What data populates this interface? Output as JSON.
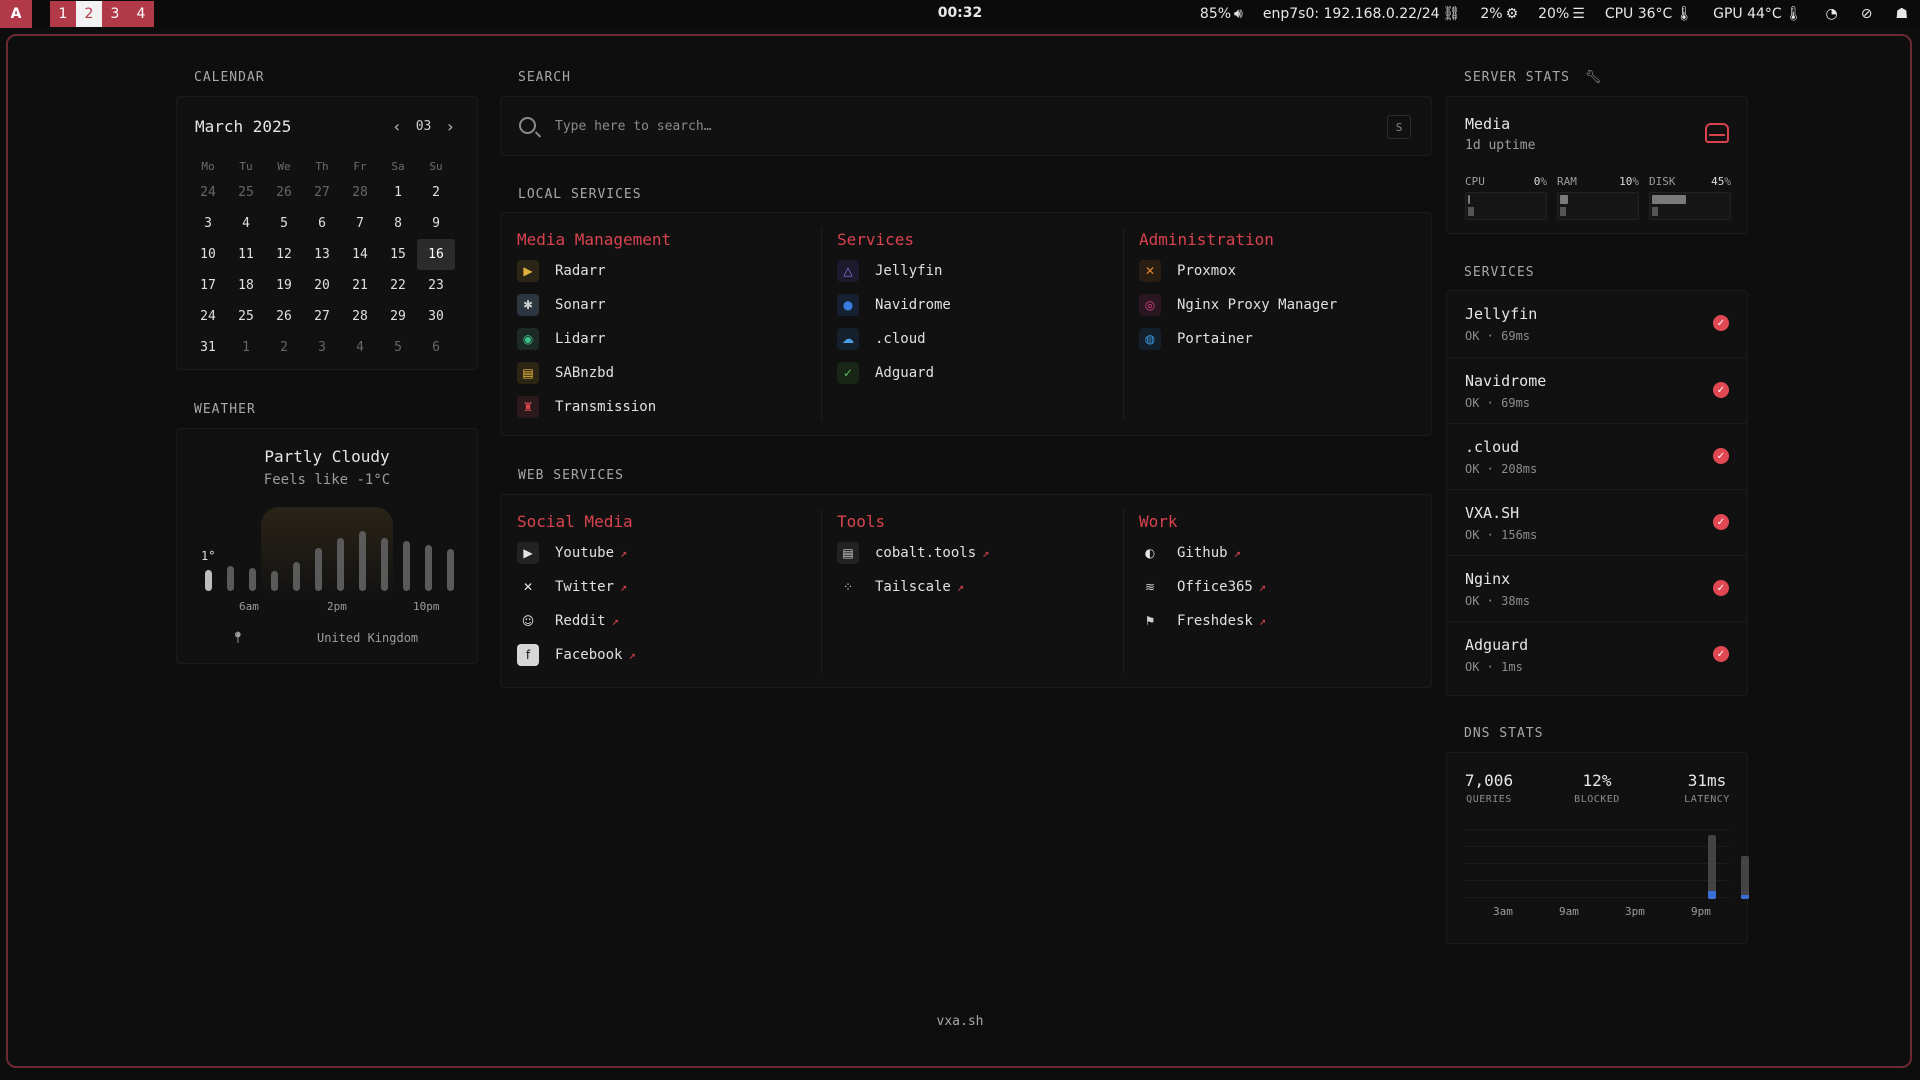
{
  "topbar": {
    "logo": "A",
    "workspaces": [
      "1",
      "2",
      "3",
      "4"
    ],
    "active_workspace": "2",
    "clock": "00:32",
    "volume": "85%",
    "network": "enp7s0: 192.168.0.22/24",
    "cpu_usage": "2%",
    "memory": "20%",
    "cpu_temp": "CPU 36°C",
    "gpu_temp": "GPU 44°C"
  },
  "calendar": {
    "label": "CALENDAR",
    "month": "March 2025",
    "month_num": "03",
    "dow": [
      "Mo",
      "Tu",
      "We",
      "Th",
      "Fr",
      "Sa",
      "Su"
    ],
    "days": [
      {
        "d": "24",
        "m": true
      },
      {
        "d": "25",
        "m": true
      },
      {
        "d": "26",
        "m": true
      },
      {
        "d": "27",
        "m": true
      },
      {
        "d": "28",
        "m": true
      },
      {
        "d": "1"
      },
      {
        "d": "2"
      },
      {
        "d": "3"
      },
      {
        "d": "4"
      },
      {
        "d": "5"
      },
      {
        "d": "6"
      },
      {
        "d": "7"
      },
      {
        "d": "8"
      },
      {
        "d": "9"
      },
      {
        "d": "10"
      },
      {
        "d": "11"
      },
      {
        "d": "12"
      },
      {
        "d": "13"
      },
      {
        "d": "14"
      },
      {
        "d": "15"
      },
      {
        "d": "16",
        "today": true
      },
      {
        "d": "17"
      },
      {
        "d": "18"
      },
      {
        "d": "19"
      },
      {
        "d": "20"
      },
      {
        "d": "21"
      },
      {
        "d": "22"
      },
      {
        "d": "23"
      },
      {
        "d": "24"
      },
      {
        "d": "25"
      },
      {
        "d": "26"
      },
      {
        "d": "27"
      },
      {
        "d": "28"
      },
      {
        "d": "29"
      },
      {
        "d": "30"
      },
      {
        "d": "31"
      },
      {
        "d": "1",
        "m": true
      },
      {
        "d": "2",
        "m": true
      },
      {
        "d": "3",
        "m": true
      },
      {
        "d": "4",
        "m": true
      },
      {
        "d": "5",
        "m": true
      },
      {
        "d": "6",
        "m": true
      }
    ]
  },
  "weather": {
    "label": "WEATHER",
    "condition": "Partly Cloudy",
    "feels_like": "Feels like -1°C",
    "current_temp": "1°",
    "ticks": [
      "6am",
      "2pm",
      "10pm"
    ],
    "location": "United Kingdom",
    "hourly_levels": [
      0.3,
      0.35,
      0.33,
      0.28,
      0.42,
      0.62,
      0.75,
      0.85,
      0.75,
      0.72,
      0.65,
      0.6
    ]
  },
  "search": {
    "label": "SEARCH",
    "placeholder": "Type here to search…",
    "shortcut": "S"
  },
  "local_services": {
    "label": "LOCAL SERVICES",
    "groups": [
      {
        "title": "Media Management",
        "items": [
          {
            "name": "Radarr",
            "icon": "radarr-icon",
            "glyph": "▶",
            "color": "#e0b040",
            "bg": "#2a2516"
          },
          {
            "name": "Sonarr",
            "icon": "sonarr-icon",
            "glyph": "✱",
            "color": "#cfcfcf",
            "bg": "#2b3640"
          },
          {
            "name": "Lidarr",
            "icon": "lidarr-icon",
            "glyph": "◉",
            "color": "#3fc28c",
            "bg": "#1b2a25"
          },
          {
            "name": "SABnzbd",
            "icon": "sabnzbd-icon",
            "glyph": "▤",
            "color": "#f0c040",
            "bg": "#2d2614"
          },
          {
            "name": "Transmission",
            "icon": "transmission-icon",
            "glyph": "♜",
            "color": "#d9434f",
            "bg": "#2a1a1c"
          }
        ]
      },
      {
        "title": "Services",
        "items": [
          {
            "name": "Jellyfin",
            "icon": "jellyfin-icon",
            "glyph": "△",
            "color": "#9b7cf0",
            "bg": "#1c1a2c"
          },
          {
            "name": "Navidrome",
            "icon": "navidrome-icon",
            "glyph": "●",
            "color": "#3a7be0",
            "bg": "#162033"
          },
          {
            "name": ".cloud",
            "icon": "cloud-icon",
            "glyph": "☁",
            "color": "#4aa0e8",
            "bg": "#14202c"
          },
          {
            "name": "Adguard",
            "icon": "adguard-icon",
            "glyph": "✓",
            "color": "#5fbf5f",
            "bg": "#172617"
          }
        ]
      },
      {
        "title": "Administration",
        "items": [
          {
            "name": "Proxmox",
            "icon": "proxmox-icon",
            "glyph": "✕",
            "color": "#e58a2c",
            "bg": "#2a1e14"
          },
          {
            "name": "Nginx Proxy Manager",
            "icon": "nginx-proxy-manager-icon",
            "glyph": "◎",
            "color": "#e04a8a",
            "bg": "#2a1620"
          },
          {
            "name": "Portainer",
            "icon": "portainer-icon",
            "glyph": "◍",
            "color": "#3aa0e8",
            "bg": "#13202c"
          }
        ]
      }
    ]
  },
  "web_services": {
    "label": "WEB SERVICES",
    "ext_arrow": "↗",
    "groups": [
      {
        "title": "Social Media",
        "items": [
          {
            "name": "Youtube",
            "icon": "youtube-icon",
            "glyph": "▶",
            "color": "#e6e6e6",
            "bg": "#222"
          },
          {
            "name": "Twitter",
            "icon": "twitter-x-icon",
            "glyph": "✕",
            "color": "#e6e6e6",
            "bg": "transparent"
          },
          {
            "name": "Reddit",
            "icon": "reddit-icon",
            "glyph": "☺",
            "color": "#e6e6e6",
            "bg": "transparent"
          },
          {
            "name": "Facebook",
            "icon": "facebook-icon",
            "glyph": "f",
            "color": "#111",
            "bg": "#d6d6d6"
          }
        ]
      },
      {
        "title": "Tools",
        "items": [
          {
            "name": "cobalt.tools",
            "icon": "cobalt-tools-icon",
            "glyph": "▤",
            "color": "#cfcfcf",
            "bg": "#222"
          },
          {
            "name": "Tailscale",
            "icon": "tailscale-icon",
            "glyph": "⁘",
            "color": "#cfcfcf",
            "bg": "transparent"
          }
        ]
      },
      {
        "title": "Work",
        "items": [
          {
            "name": "Github",
            "icon": "github-icon",
            "glyph": "◐",
            "color": "#e6e6e6",
            "bg": "transparent"
          },
          {
            "name": "Office365",
            "icon": "office365-icon",
            "glyph": "≋",
            "color": "#cfcfcf",
            "bg": "transparent"
          },
          {
            "name": "Freshdesk",
            "icon": "freshdesk-icon",
            "glyph": "⚑",
            "color": "#cfcfcf",
            "bg": "transparent"
          }
        ]
      }
    ]
  },
  "server_stats": {
    "label": "SERVER STATS",
    "name": "Media",
    "uptime": "1d uptime",
    "metrics": [
      {
        "label": "CPU",
        "value": "0",
        "unit": "%",
        "fraction": 0.0
      },
      {
        "label": "RAM",
        "value": "10",
        "unit": "%",
        "fraction": 0.1
      },
      {
        "label": "DISK",
        "value": "45",
        "unit": "%",
        "fraction": 0.45
      }
    ]
  },
  "services_status": {
    "label": "SERVICES",
    "items": [
      {
        "name": "Jellyfin",
        "meta": "OK · 69ms"
      },
      {
        "name": "Navidrome",
        "meta": "OK · 69ms"
      },
      {
        "name": ".cloud",
        "meta": "OK · 208ms"
      },
      {
        "name": "VXA.SH",
        "meta": "OK · 156ms"
      },
      {
        "name": "Nginx",
        "meta": "OK · 38ms"
      },
      {
        "name": "Adguard",
        "meta": "OK · 1ms"
      }
    ]
  },
  "dns_stats": {
    "label": "DNS STATS",
    "stats": [
      {
        "value": "7,006",
        "label": "QUERIES"
      },
      {
        "value": "12%",
        "label": "BLOCKED"
      },
      {
        "value": "31ms",
        "label": "LATENCY"
      }
    ],
    "ticks": [
      "3am",
      "9am",
      "3pm",
      "9pm"
    ],
    "bars": [
      {
        "slot": 7,
        "queries": 0.92,
        "blocked": 0.12
      },
      {
        "slot": 8,
        "queries": 0.62,
        "blocked": 0.05
      }
    ],
    "blocked_color": "#3b6fd8"
  },
  "footer": "vxa.sh",
  "colors": {
    "accent": "#d9434f",
    "frame": "#6e2a33",
    "workspace": "#b23a48"
  }
}
